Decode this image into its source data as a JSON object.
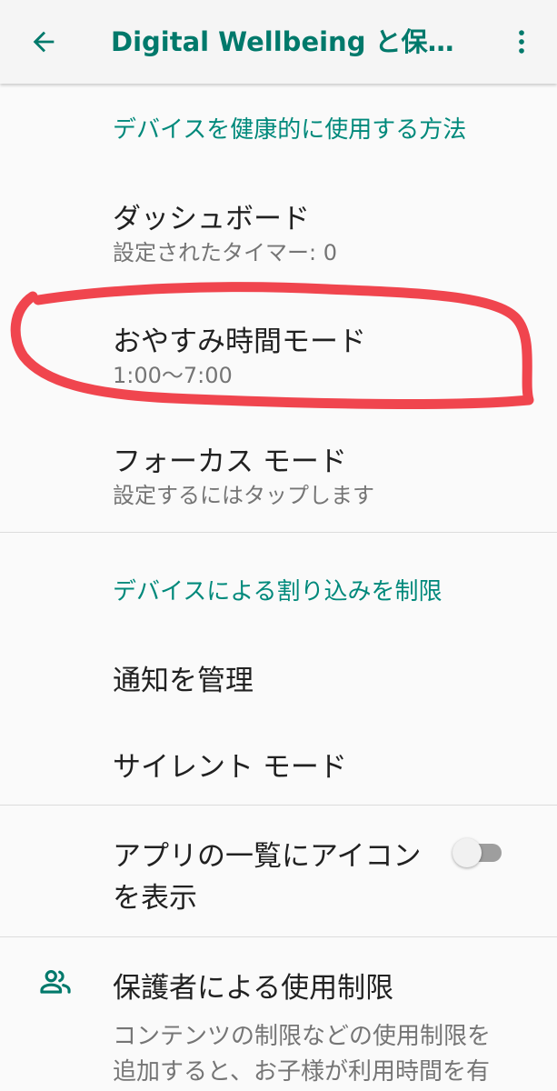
{
  "appbar": {
    "title": "Digital Wellbeing と保護…",
    "back_icon": "arrow-back-icon",
    "menu_icon": "more-vert-icon"
  },
  "section1": {
    "header": "デバイスを健康的に使用する方法",
    "items": [
      {
        "title": "ダッシュボード",
        "subtitle": "設定されたタイマー: 0"
      },
      {
        "title": "おやすみ時間モード",
        "subtitle": "1:00〜7:00"
      },
      {
        "title": "フォーカス モード",
        "subtitle": "設定するにはタップします"
      }
    ]
  },
  "section2": {
    "header": "デバイスによる割り込みを制限",
    "items": [
      {
        "title": "通知を管理"
      },
      {
        "title": "サイレント モード"
      }
    ]
  },
  "app_icon_setting": {
    "line1": "アプリの一覧にアイコン",
    "line2": "を表示",
    "toggle_on": false
  },
  "parental": {
    "icon": "people-icon",
    "title": "保護者による使用制限",
    "desc_line1": "コンテンツの制限などの使用制限を",
    "desc_line2": "追加すると、お子様が利用時間を有"
  },
  "colors": {
    "accent": "#00796b",
    "annotation": "#f0454e"
  }
}
